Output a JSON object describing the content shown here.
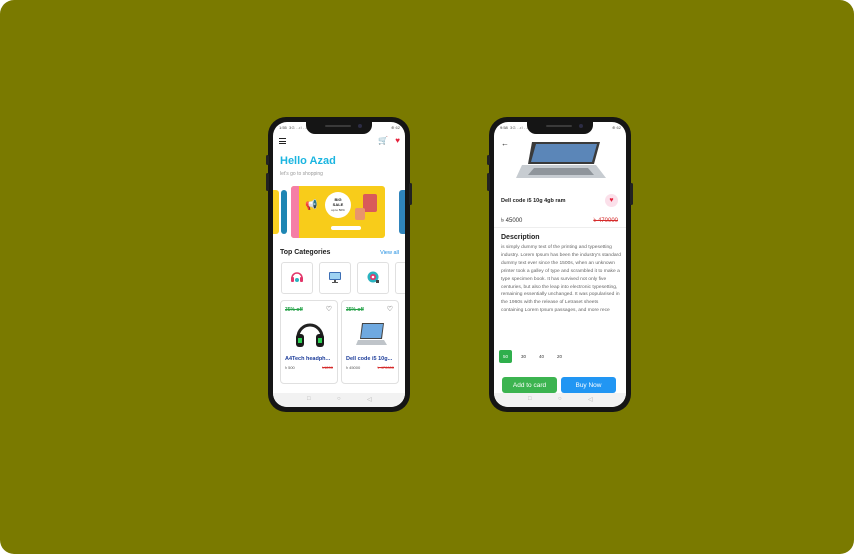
{
  "left_screen": {
    "status": {
      "time": "1:55",
      "signal": "3G ..ıl ..ıl",
      "right": "⊕ 62"
    },
    "greeting": "Hello Azad",
    "subtitle": "let's go to shopping",
    "banner": {
      "sale_line1": "BIG",
      "sale_line2": "SALE",
      "sale_line3": "up to 50%"
    },
    "categories_title": "Top Categories",
    "view_all": "View all",
    "categories": [
      {
        "icon": "headphones-icon"
      },
      {
        "icon": "monitor-icon"
      },
      {
        "icon": "camera-icon"
      }
    ],
    "products": [
      {
        "discount": "35% off",
        "name": "A4Tech headph...",
        "price": "৳ 500",
        "old_price": "৳1200"
      },
      {
        "discount": "35% off",
        "name": "Dell code i5 10g...",
        "price": "৳ 45000",
        "old_price": "৳ 470000"
      }
    ]
  },
  "right_screen": {
    "status": {
      "time": "9:58",
      "signal": "3G ..ıl ..ıl",
      "right": "⊕ 62"
    },
    "title": "Dell code i5 10g 4gb ram",
    "price": "৳ 45000",
    "old_price": "৳ 470000",
    "description_title": "Description",
    "description": "is simply dummy text of the printing and typesetting industry. Lorem Ipsum has been the industry's standard dummy text ever since the 1500s, when an unknown printer took a galley of type and scrambled it to make a type specimen book. It has survived not only five centuries, but also the leap into electronic typesetting, remaining essentially unchanged. It was popularised in the 1960s with the release of Letraset sheets containing Lorem Ipsum passages, and more rece",
    "sizes": [
      "50",
      "30",
      "40",
      "20"
    ],
    "add_to_cart": "Add to card",
    "buy_now": "Buy Now"
  },
  "nav": {
    "square": "□",
    "circle": "○",
    "back": "◁"
  },
  "colors": {
    "background": "#7a7a00",
    "accent_blue": "#1bb5e0",
    "green": "#3cb450",
    "buy_blue": "#2196f3",
    "heart_red": "#e5213b"
  }
}
